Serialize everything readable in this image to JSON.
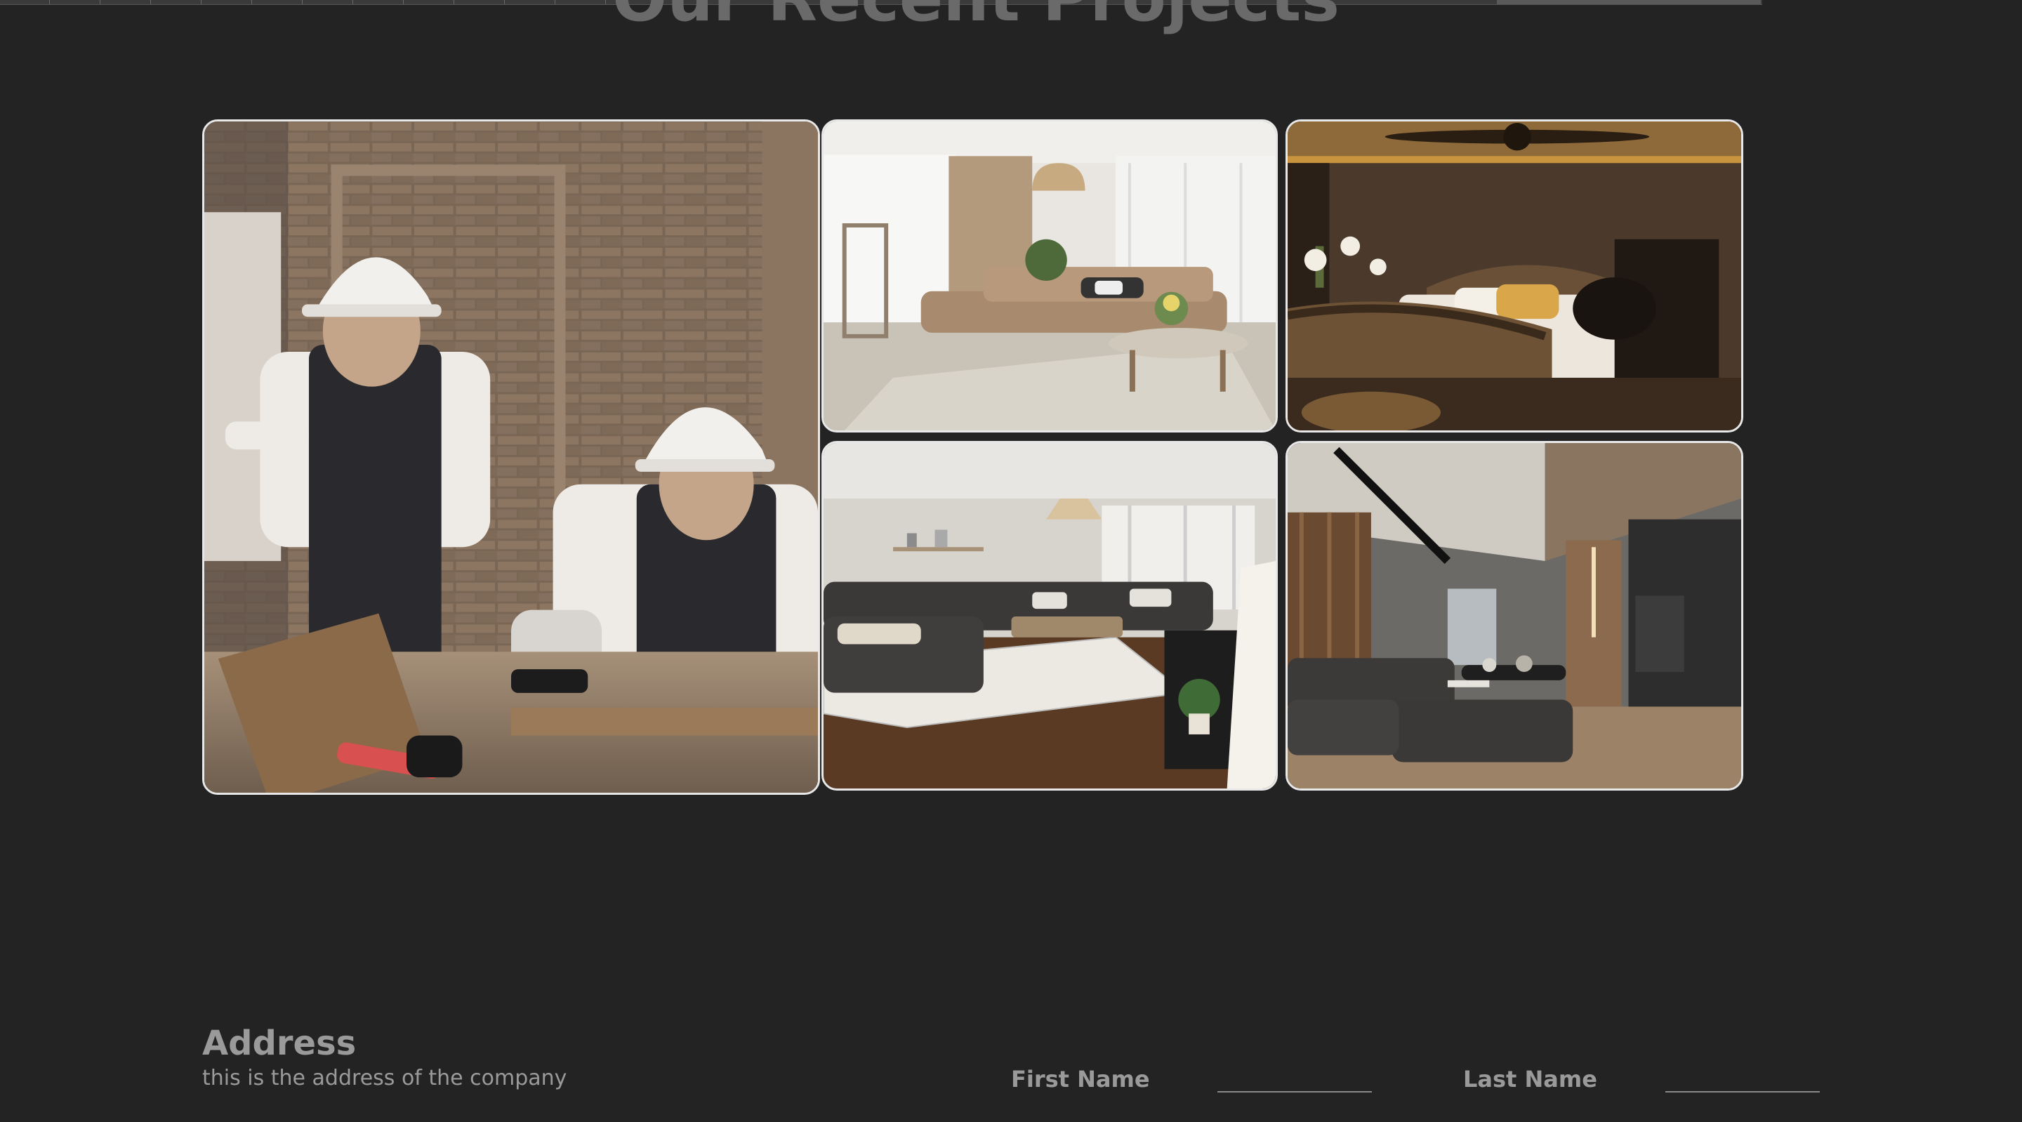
{
  "projects": {
    "title": "Our Recent Projects",
    "images": [
      {
        "alt": "construction-workers-photo"
      },
      {
        "alt": "bright-living-room-photo"
      },
      {
        "alt": "dark-bedroom-photo"
      },
      {
        "alt": "grey-sofa-living-room-photo"
      },
      {
        "alt": "modern-dark-lounge-photo"
      }
    ]
  },
  "contact": {
    "address_heading": "Address",
    "address_text": "this is the address of the company",
    "first_name_label": "First Name",
    "first_name_value": "",
    "last_name_label": "Last Name",
    "last_name_value": ""
  },
  "colors": {
    "background": "#232323",
    "card_border": "#e8e8e8",
    "text": "#9a9a9a"
  }
}
